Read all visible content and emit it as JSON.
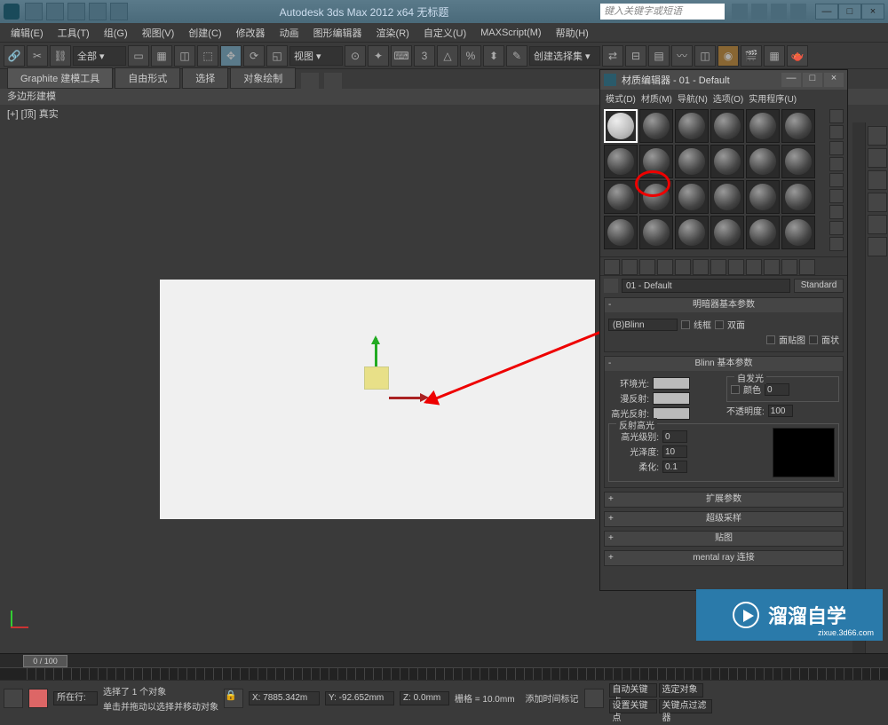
{
  "titlebar": {
    "title": "Autodesk 3ds Max 2012 x64   无标题",
    "search_placeholder": "键入关键字或短语",
    "min": "—",
    "max": "□",
    "close": "×"
  },
  "menubar": [
    "编辑(E)",
    "工具(T)",
    "组(G)",
    "视图(V)",
    "创建(C)",
    "修改器",
    "动画",
    "图形编辑器",
    "渲染(R)",
    "自定义(U)",
    "MAXScript(M)",
    "帮助(H)"
  ],
  "toolbar": {
    "all": "全部 ▾",
    "view_label": "视图 ▾",
    "selset": "创建选择集 ▾"
  },
  "ribbon": {
    "tabs": [
      "Graphite 建模工具",
      "自由形式",
      "选择",
      "对象绘制"
    ]
  },
  "polybar": "多边形建模",
  "viewlabels": "[+] [顶] 真实",
  "mateditor": {
    "title": "材质编辑器 - 01 - Default",
    "menu": [
      "模式(D)",
      "材质(M)",
      "导航(N)",
      "选项(O)",
      "实用程序(U)"
    ],
    "name": "01 - Default",
    "standard": "Standard",
    "rollouts": {
      "shader_basic": "明暗器基本参数",
      "shader": "(B)Blinn",
      "wire": "线框",
      "twoSided": "双面",
      "faceMap": "面贴图",
      "faceted": "面状",
      "blinn_basic": "Blinn 基本参数",
      "selfIllum": "自发光",
      "ambient": "环境光:",
      "diffuse": "漫反射:",
      "specular": "高光反射:",
      "color": "颜色",
      "colorVal": "0",
      "opacity": "不透明度:",
      "opacityVal": "100",
      "specHighlights": "反射高光",
      "specLevel": "高光级别:",
      "specLevelVal": "0",
      "gloss": "光泽度:",
      "glossVal": "10",
      "soften": "柔化:",
      "softenVal": "0.1",
      "ext": "扩展参数",
      "super": "超级采样",
      "maps": "贴图",
      "mental": "mental ray 连接"
    }
  },
  "timeline": {
    "frame": "0 / 100"
  },
  "status": {
    "selected": "选择了 1 个对象",
    "hint": "单击并拖动以选择并移动对象",
    "x": "X: 7885.342m",
    "y": "Y: -92.652mm",
    "z": "Z: 0.0mm",
    "grid": "栅格 = 10.0mm",
    "autokey": "自动关键点",
    "selkey": "选定对象",
    "setkey": "设置关键点",
    "keyfilter": "关键点过滤器",
    "addtime": "添加时间标记",
    "nowrow": "所在行:"
  },
  "watermark": {
    "name": "溜溜自学",
    "url": "zixue.3d66.com"
  }
}
